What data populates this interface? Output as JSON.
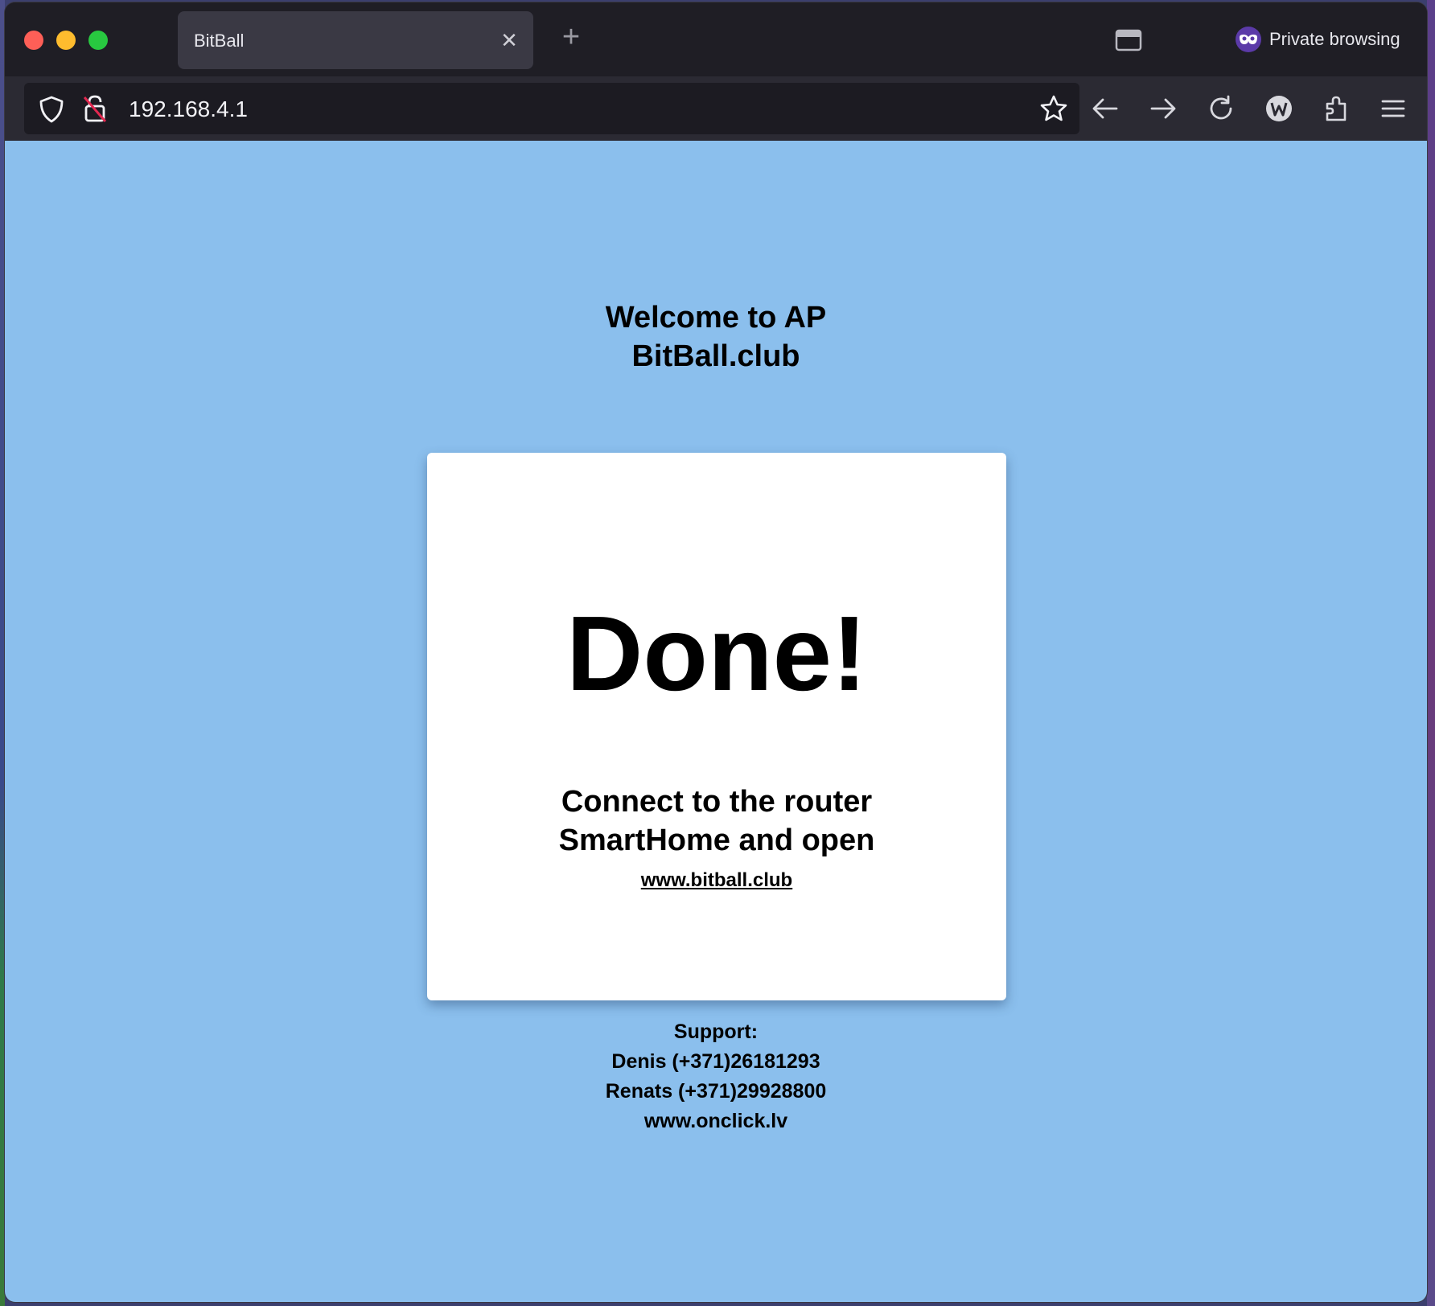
{
  "browser": {
    "tab_title": "BitBall",
    "tab_close_glyph": "✕",
    "new_tab_glyph": "+",
    "private_label": "Private browsing",
    "url": "192.168.4.1",
    "icons": [
      "shield-icon",
      "insecure-lock-icon",
      "bookmark-star-icon",
      "back-icon",
      "forward-icon",
      "reload-icon",
      "account-icon",
      "extensions-icon",
      "menu-icon",
      "tab-manager-icon",
      "private-mask-icon"
    ]
  },
  "page": {
    "welcome_line1": "Welcome to AP",
    "welcome_line2": "BitBall.club",
    "done": "Done!",
    "connect_line1": "Connect to the router",
    "connect_line2": "SmartHome and open",
    "link": "www.bitball.club",
    "support_title": "Support:",
    "support_line1": "Denis (+371)26181293",
    "support_line2": "Renats (+371)29928800",
    "support_line3": "www.onclick.lv",
    "background_color": "#8bbfed"
  }
}
